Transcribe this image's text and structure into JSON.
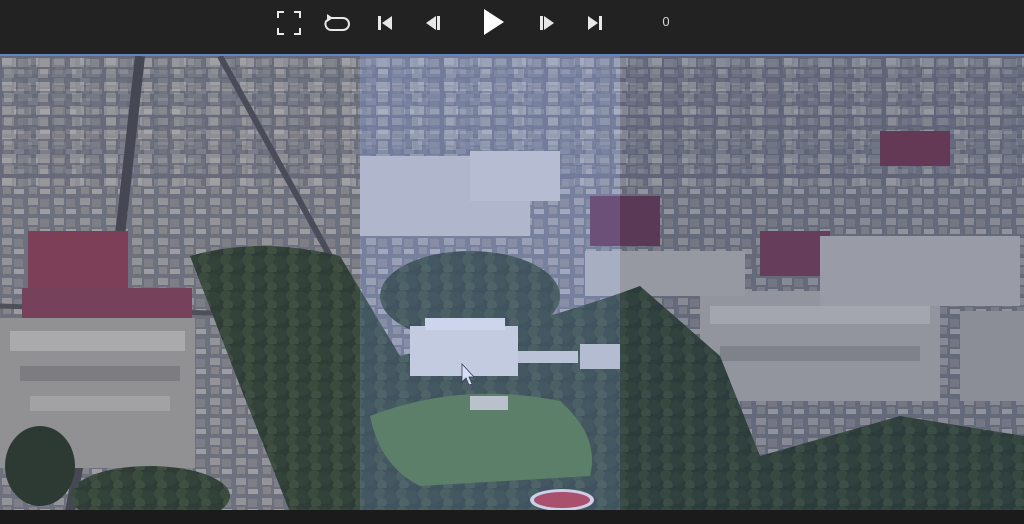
{
  "toolbar": {
    "buttons": [
      {
        "name": "fullscreen-button",
        "icon": "fullscreen-icon"
      },
      {
        "name": "loop-button",
        "icon": "loop-icon"
      },
      {
        "name": "skip-to-start-button",
        "icon": "skip-start-icon"
      },
      {
        "name": "step-back-button",
        "icon": "step-back-icon"
      },
      {
        "name": "play-button",
        "icon": "play-icon"
      },
      {
        "name": "step-forward-button",
        "icon": "step-forward-icon"
      },
      {
        "name": "skip-to-end-button",
        "icon": "skip-end-icon"
      }
    ],
    "frame_counter": "0"
  },
  "viewport": {
    "content": "aerial-3d-city-view",
    "panels": [
      "left",
      "center-highlighted",
      "right"
    ]
  },
  "colors": {
    "toolbar_bg": "#222222",
    "icon": "#e8e8e8",
    "viewport_border": "#5f86c4",
    "highlight_tint": "#8fa6e6"
  }
}
